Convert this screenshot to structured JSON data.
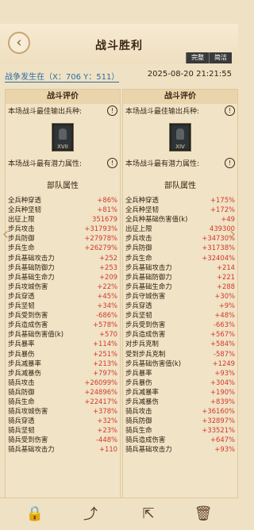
{
  "header": {
    "title": "战斗胜利",
    "btn_full": "完整",
    "btn_simple": "简洁"
  },
  "location": "战争发生在（X：706 Y：511）",
  "datetime": "2025-08-20  21:21:55",
  "left_panel": {
    "title": "战斗评价",
    "best_output_label": "本场战斗最佳输出兵种:",
    "unit_numeral": "XVII",
    "potential_label": "本场战斗最有潜力属性:",
    "stats_title": "部队属性",
    "stats": [
      {
        "name": "全兵种穿透",
        "value": "+86%"
      },
      {
        "name": "全兵种坚韧",
        "value": "+81%"
      },
      {
        "name": "出征上限",
        "value": "351679"
      },
      {
        "name": "步兵攻击",
        "value": "+31793%"
      },
      {
        "name": "步兵防御",
        "value": "+27978%"
      },
      {
        "name": "步兵生命",
        "value": "+26279%"
      },
      {
        "name": "步兵基础攻击力",
        "value": "+252"
      },
      {
        "name": "步兵基础防御力",
        "value": "+253"
      },
      {
        "name": "步兵基础生命力",
        "value": "+209"
      },
      {
        "name": "步兵攻城伤害",
        "value": "+22%"
      },
      {
        "name": "步兵穿透",
        "value": "+45%"
      },
      {
        "name": "步兵坚韧",
        "value": "+34%"
      },
      {
        "name": "步兵受到伤害",
        "value": "-686%"
      },
      {
        "name": "步兵造成伤害",
        "value": "+578%"
      },
      {
        "name": "步兵基础伤害值(k)",
        "value": "+570"
      },
      {
        "name": "步兵暴率",
        "value": "+114%"
      },
      {
        "name": "步兵暴伤",
        "value": "+251%"
      },
      {
        "name": "步兵减暴率",
        "value": "+213%"
      },
      {
        "name": "步兵减暴伤",
        "value": "+797%"
      },
      {
        "name": "骑兵攻击",
        "value": "+26099%"
      },
      {
        "name": "骑兵防御",
        "value": "+24896%"
      },
      {
        "name": "骑兵生命",
        "value": "+22417%"
      },
      {
        "name": "骑兵攻城伤害",
        "value": "+378%"
      },
      {
        "name": "骑兵穿透",
        "value": "+32%"
      },
      {
        "name": "骑兵坚韧",
        "value": "+23%"
      },
      {
        "name": "骑兵受到伤害",
        "value": "-448%"
      },
      {
        "name": "骑兵基础攻击力",
        "value": "+110"
      }
    ]
  },
  "right_panel": {
    "title": "战斗评价",
    "best_output_label": "本场战斗最佳输出兵种:",
    "unit_numeral": "XIV",
    "potential_label": "本场战斗最有潜力属性:",
    "stats_title": "部队属性",
    "stats": [
      {
        "name": "全兵种穿透",
        "value": "+175%"
      },
      {
        "name": "全兵种坚韧",
        "value": "+172%"
      },
      {
        "name": "全兵种基础伤害值(k)",
        "value": "+49"
      },
      {
        "name": "出征上限",
        "value": "439300"
      },
      {
        "name": "步兵攻击",
        "value": "+34730%"
      },
      {
        "name": "步兵防御",
        "value": "+31738%"
      },
      {
        "name": "步兵生命",
        "value": "+32404%"
      },
      {
        "name": "步兵基础攻击力",
        "value": "+214"
      },
      {
        "name": "步兵基础防御力",
        "value": "+221"
      },
      {
        "name": "步兵基础生命力",
        "value": "+288"
      },
      {
        "name": "步兵守城伤害",
        "value": "+30%"
      },
      {
        "name": "步兵穿透",
        "value": "+9%"
      },
      {
        "name": "步兵坚韧",
        "value": "+48%"
      },
      {
        "name": "步兵受到伤害",
        "value": "-663%"
      },
      {
        "name": "步兵造成伤害",
        "value": "+567%"
      },
      {
        "name": "对步兵克制",
        "value": "+584%"
      },
      {
        "name": "受到步兵克制",
        "value": "-587%"
      },
      {
        "name": "步兵基础伤害值(k)",
        "value": "+1249"
      },
      {
        "name": "步兵暴率",
        "value": "+93%"
      },
      {
        "name": "步兵暴伤",
        "value": "+304%"
      },
      {
        "name": "步兵减暴率",
        "value": "+190%"
      },
      {
        "name": "步兵减暴伤",
        "value": "+839%"
      },
      {
        "name": "骑兵攻击",
        "value": "+36160%"
      },
      {
        "name": "骑兵防御",
        "value": "+32897%"
      },
      {
        "name": "骑兵生命",
        "value": "+33521%"
      },
      {
        "name": "骑兵造成伤害",
        "value": "+647%"
      },
      {
        "name": "骑兵基础攻击力",
        "value": "+93%"
      }
    ]
  },
  "icons": {
    "lock": "lock-icon",
    "share": "share-icon",
    "export": "export-icon",
    "delete": "trash-icon"
  }
}
